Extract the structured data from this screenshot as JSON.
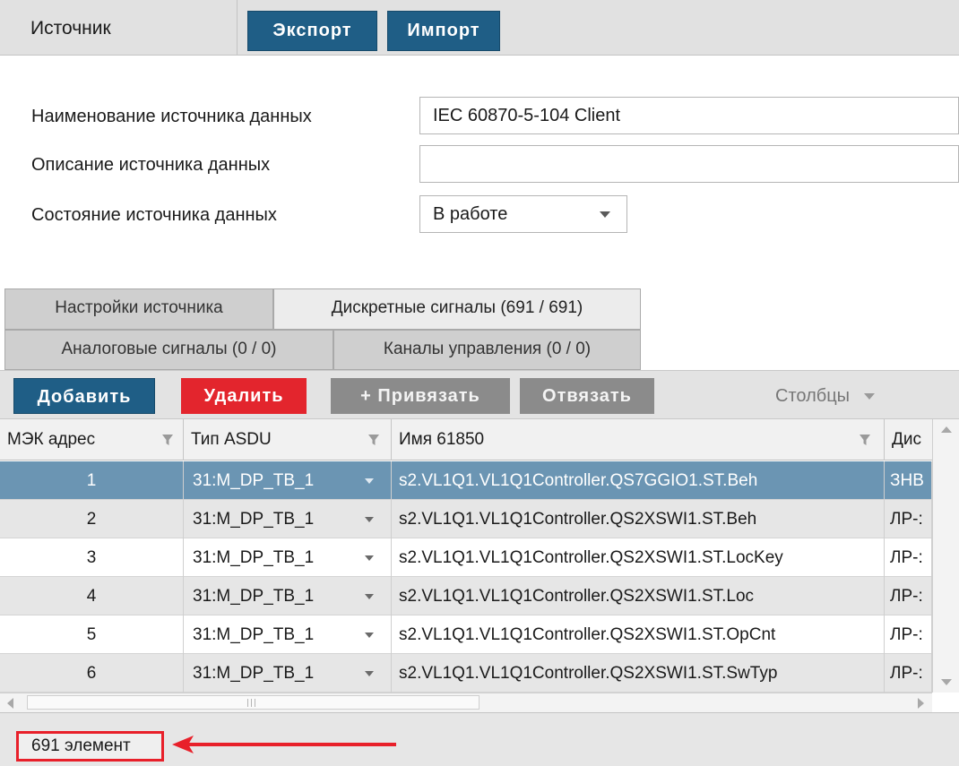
{
  "top_tabs": {
    "source": "Источник",
    "export": "Экспорт",
    "import": "Импорт"
  },
  "form": {
    "name_label": "Наименование источника данных",
    "name_value": "IEC 60870-5-104 Client",
    "desc_label": "Описание источника данных",
    "desc_value": "",
    "state_label": "Состояние источника данных",
    "state_value": "В работе"
  },
  "tabs": {
    "settings": "Настройки источника",
    "discrete": "Дискретные сигналы (691 / 691)",
    "analog": "Аналоговые сигналы (0 / 0)",
    "control": "Каналы управления (0 / 0)"
  },
  "toolbar": {
    "add": "Добавить",
    "delete": "Удалить",
    "bind": "+ Привязать",
    "unbind": "Отвязать",
    "columns": "Столбцы"
  },
  "table": {
    "columns": [
      "МЭК адрес",
      "Тип ASDU",
      "Имя 61850",
      "Дис"
    ],
    "rows": [
      {
        "addr": "1",
        "asdu": "31:M_DP_TB_1",
        "name": "s2.VL1Q1.VL1Q1Controller.QS7GGIO1.ST.Beh",
        "dis": "ЗНВ"
      },
      {
        "addr": "2",
        "asdu": "31:M_DP_TB_1",
        "name": "s2.VL1Q1.VL1Q1Controller.QS2XSWI1.ST.Beh",
        "dis": "ЛР-:"
      },
      {
        "addr": "3",
        "asdu": "31:M_DP_TB_1",
        "name": "s2.VL1Q1.VL1Q1Controller.QS2XSWI1.ST.LocKey",
        "dis": "ЛР-:"
      },
      {
        "addr": "4",
        "asdu": "31:M_DP_TB_1",
        "name": "s2.VL1Q1.VL1Q1Controller.QS2XSWI1.ST.Loc",
        "dis": "ЛР-:"
      },
      {
        "addr": "5",
        "asdu": "31:M_DP_TB_1",
        "name": "s2.VL1Q1.VL1Q1Controller.QS2XSWI1.ST.OpCnt",
        "dis": "ЛР-:"
      },
      {
        "addr": "6",
        "asdu": "31:M_DP_TB_1",
        "name": "s2.VL1Q1.VL1Q1Controller.QS2XSWI1.ST.SwTyp",
        "dis": "ЛР-:"
      }
    ],
    "selected_index": 0
  },
  "status": {
    "count": "691 элемент"
  },
  "colors": {
    "accent_dark": "#1f5e86",
    "danger": "#e3252d",
    "selection": "#6b95b3",
    "annotation": "#e8202a"
  }
}
